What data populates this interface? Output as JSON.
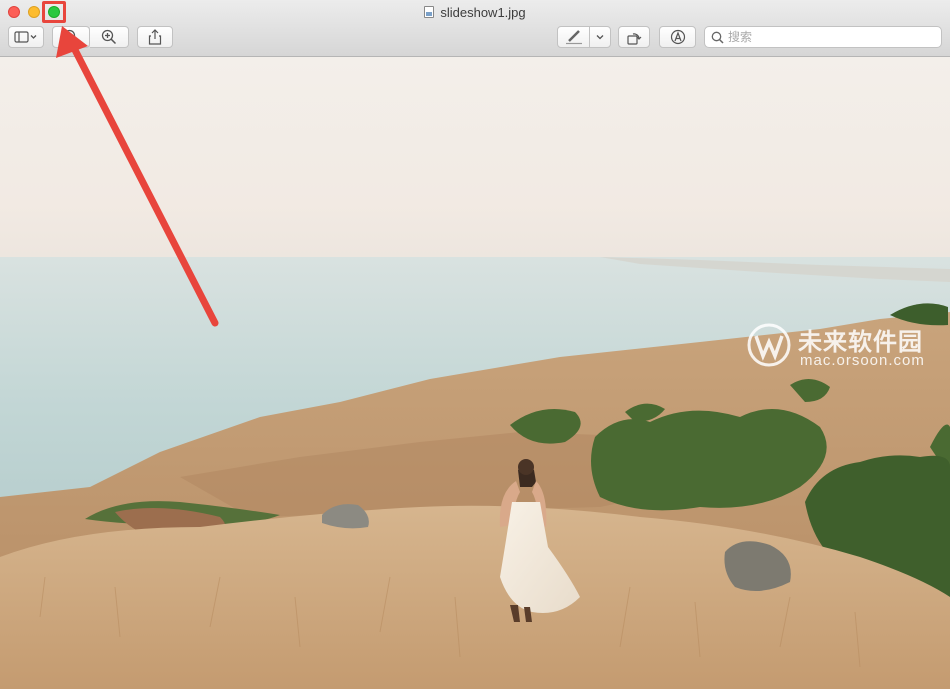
{
  "window": {
    "title": "slideshow1.jpg"
  },
  "toolbar": {
    "sidebar_icon": "sidebar-icon",
    "zoom_out_icon": "zoom-out-icon",
    "zoom_in_icon": "zoom-in-icon",
    "share_icon": "share-icon",
    "markup_icon": "pen-icon",
    "markup_dropdown_icon": "chevron-down-icon",
    "rotate_icon": "rotate-icon",
    "annotate_icon": "markup-circle-icon"
  },
  "search": {
    "placeholder": "搜索",
    "value": ""
  },
  "watermark": {
    "brand": "未来软件园",
    "url": "mac.orsoon.com"
  },
  "colors": {
    "close": "#fc5f57",
    "minimize": "#fdbc2e",
    "maximize": "#29c840",
    "annotation": "#e8453c"
  }
}
